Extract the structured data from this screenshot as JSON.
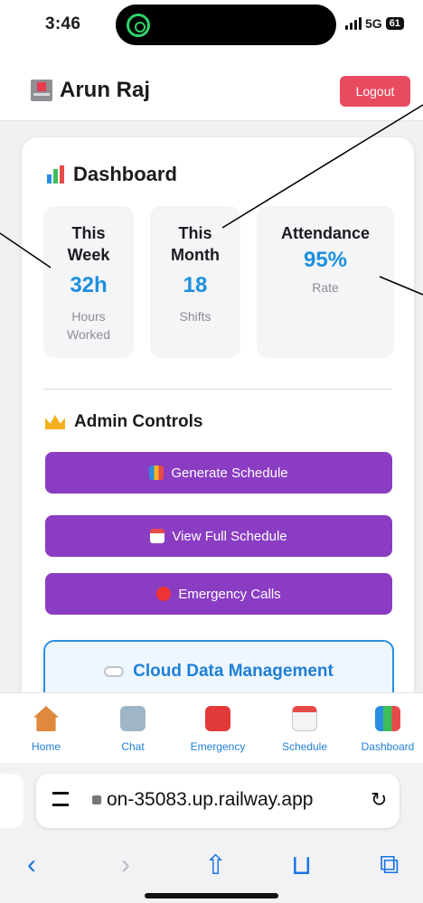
{
  "status_bar": {
    "time": "3:46",
    "network": "5G",
    "battery": "61"
  },
  "header": {
    "user_name": "Arun Raj",
    "logout_label": "Logout"
  },
  "dashboard": {
    "title": "Dashboard",
    "stats": [
      {
        "label_line1": "This",
        "label_line2": "Week",
        "value": "32h",
        "sub_line1": "Hours",
        "sub_line2": "Worked"
      },
      {
        "label_line1": "This",
        "label_line2": "Month",
        "value": "18",
        "sub_line1": "Shifts"
      },
      {
        "label_line1": "Attendance",
        "value": "95%",
        "sub_line1": "Rate"
      }
    ]
  },
  "admin": {
    "title": "Admin Controls",
    "actions": [
      {
        "label": "Generate Schedule",
        "icon": "chart-icon"
      },
      {
        "label": "View Full Schedule",
        "icon": "calendar-icon"
      },
      {
        "label": "Emergency Calls",
        "icon": "siren-icon"
      }
    ]
  },
  "cloud": {
    "title": "Cloud Data Management",
    "icon": "cloud-icon"
  },
  "bottom_nav": [
    {
      "label": "Home",
      "icon": "home-icon"
    },
    {
      "label": "Chat",
      "icon": "robot-icon"
    },
    {
      "label": "Emergency",
      "icon": "siren-icon"
    },
    {
      "label": "Schedule",
      "icon": "calendar-icon"
    },
    {
      "label": "Dashboard",
      "icon": "chart-icon"
    }
  ],
  "browser": {
    "url": "on-35083.up.railway.app"
  },
  "colors": {
    "accent_blue": "#1e8fe0",
    "admin_purple": "#8a3cc2",
    "logout_red": "#e84a5f"
  }
}
